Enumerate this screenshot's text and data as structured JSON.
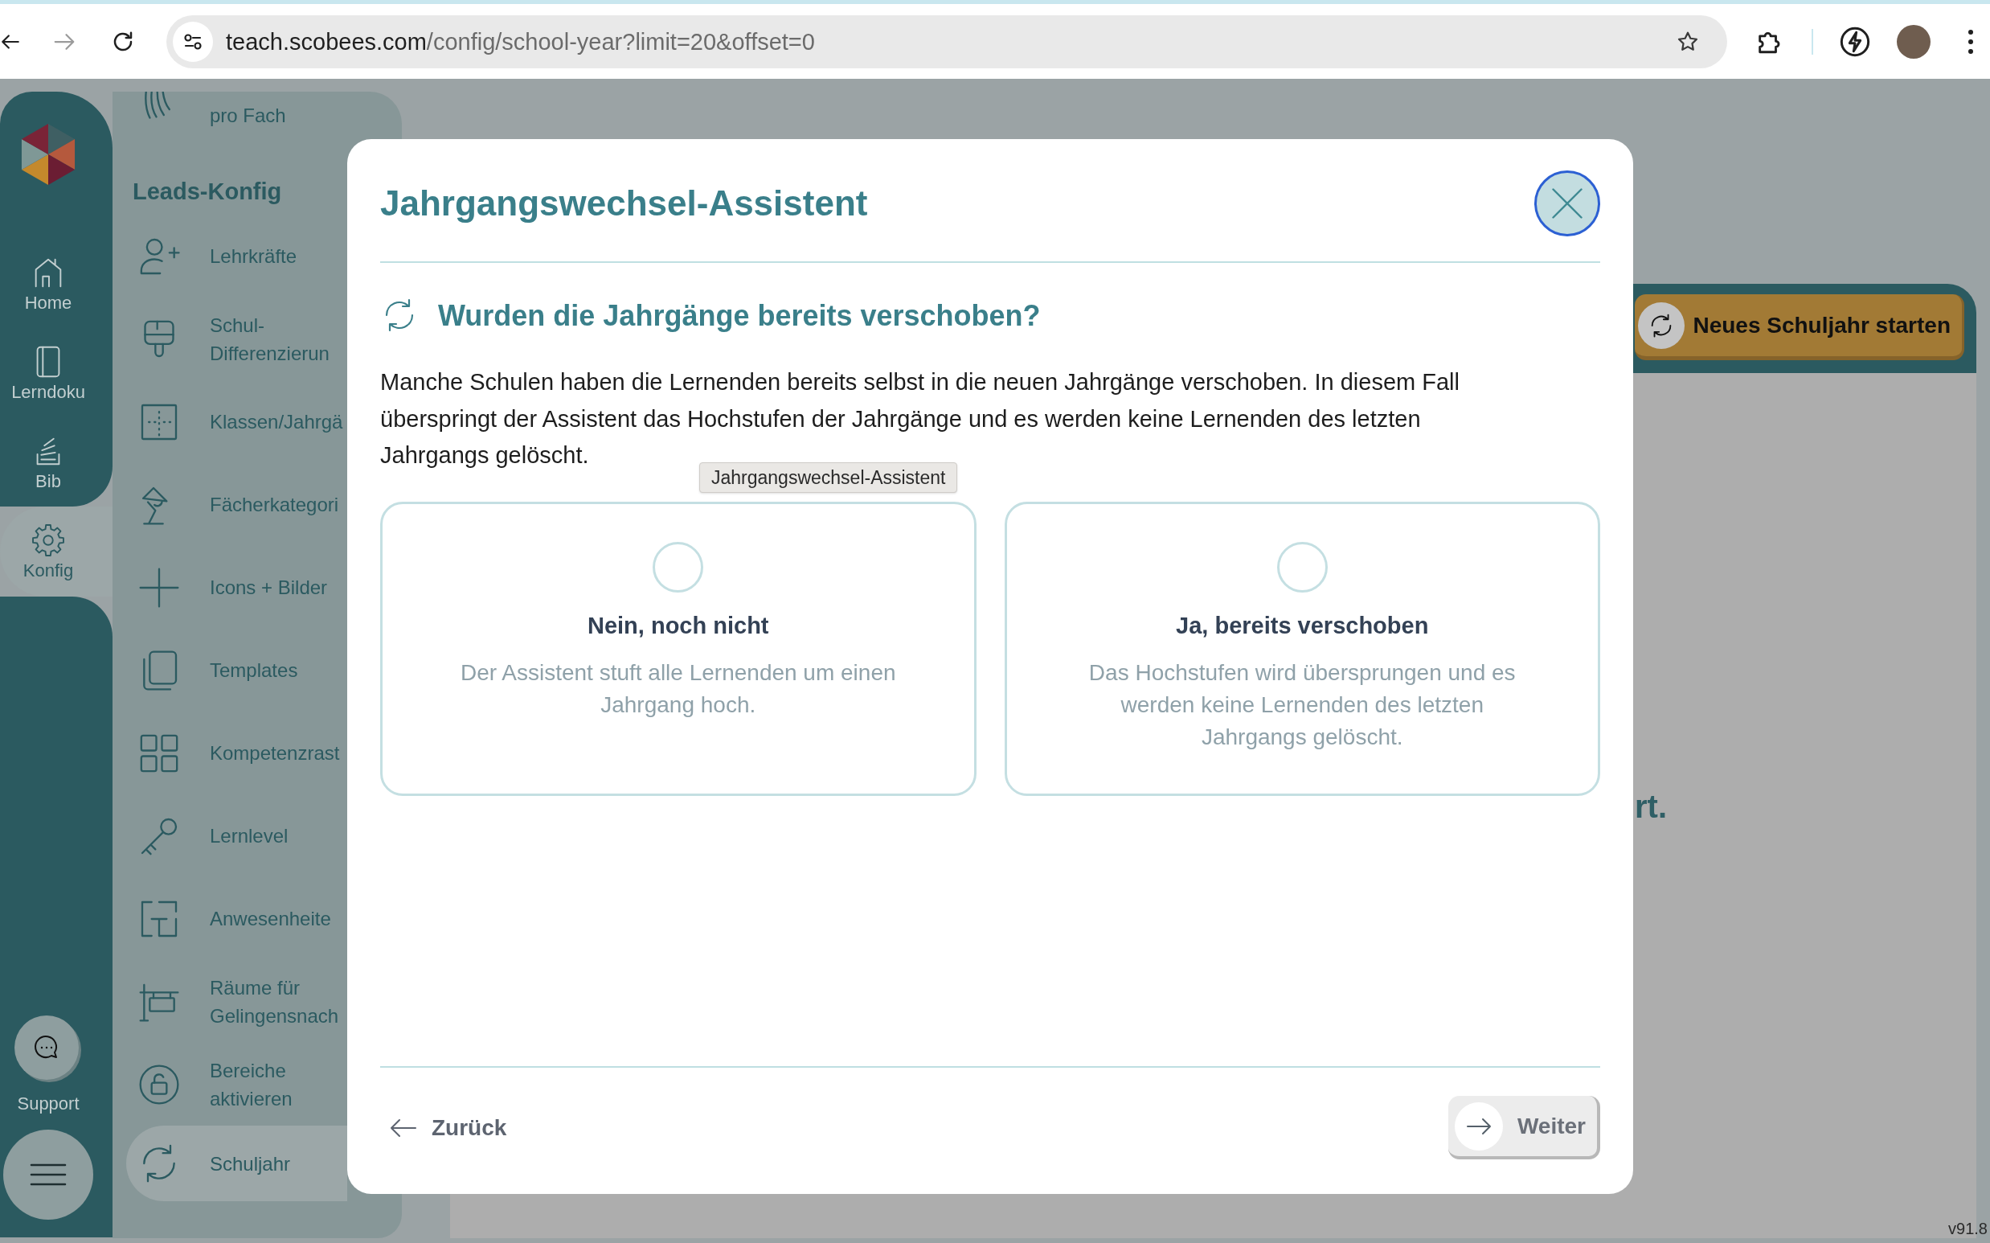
{
  "browser": {
    "url": {
      "host": "teach.scobees.com",
      "path": "/config/school-year?limit=20&offset=0"
    }
  },
  "rail": {
    "items": [
      {
        "label": "Home",
        "selected": false
      },
      {
        "label": "Lerndoku",
        "selected": false
      },
      {
        "label": "Bib",
        "selected": false
      },
      {
        "label": "Konfig",
        "selected": true
      }
    ],
    "support": {
      "label": "Support"
    }
  },
  "sidebar": {
    "items": [
      {
        "label": "pro Fach",
        "selected": false
      }
    ],
    "section": {
      "title": "Leads-Konfig",
      "items": [
        {
          "label": "Lehrkräfte",
          "selected": false
        },
        {
          "label": "Schul-Differenzierun",
          "selected": false
        },
        {
          "label": "Klassen/Jahrgä",
          "selected": false
        },
        {
          "label": "Fächerkategori",
          "selected": false
        },
        {
          "label": "Icons + Bilder",
          "selected": false
        },
        {
          "label": "Templates",
          "selected": false
        },
        {
          "label": "Kompetenzrast",
          "selected": false
        },
        {
          "label": "Lernlevel",
          "selected": false
        },
        {
          "label": "Anwesenheite",
          "selected": false
        },
        {
          "label": "Räume für Gelingensnach",
          "selected": false
        },
        {
          "label": "Bereiche aktivieren",
          "selected": false
        },
        {
          "label": "Schuljahr",
          "selected": true
        }
      ]
    }
  },
  "main": {
    "header_button": {
      "label": "Neues Schuljahr starten"
    },
    "message_fragment": "rt."
  },
  "dialog": {
    "title": "Jahrgangswechsel-Assistent",
    "question": "Wurden die Jahrgänge bereits verschoben?",
    "description": "Manche Schulen haben die Lernenden bereits selbst in die neuen Jahrgänge verschoben. In diesem Fall überspringt der Assistent das Hochstufen der Jahrgänge und es werden keine Lernenden des letzten Jahrgangs gelöscht.",
    "tooltip": "Jahrgangswechsel-Assistent",
    "options": [
      {
        "title": "Nein, noch nicht",
        "description": "Der Assistent stuft alle Lernenden um einen Jahrgang hoch.",
        "selected": false
      },
      {
        "title": "Ja, bereits verschoben",
        "description": "Das Hochstufen wird übersprungen und es werden keine Lernenden des letzten Jahrgangs gelöscht.",
        "selected": false
      }
    ],
    "back_button": {
      "label": "Zurück"
    },
    "next_button": {
      "label": "Weiter",
      "disabled": true
    }
  },
  "version": "v91.8"
}
